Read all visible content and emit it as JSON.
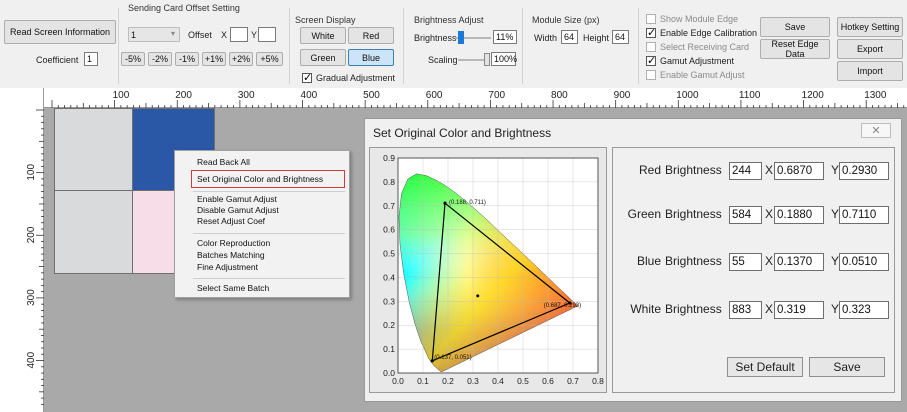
{
  "toolbar": {
    "read_screen_info": "Read Screen Information",
    "coefficient_label": "Coefficient",
    "coefficient_value": "1",
    "sending_card": {
      "title": "Sending Card Offset Setting",
      "selected": "1",
      "offset_label": "Offset",
      "x_label": "X",
      "y_label": "Y",
      "x_value": "",
      "y_value": "",
      "steps": [
        "-5%",
        "-2%",
        "-1%",
        "+1%",
        "+2%",
        "+5%"
      ]
    },
    "screen_display": {
      "title": "Screen Display",
      "white": "White",
      "red": "Red",
      "green": "Green",
      "blue": "Blue",
      "gradual": "Gradual Adjustment"
    },
    "brightness_adjust": {
      "title": "Brightness Adjust",
      "brightness_label": "Brightness",
      "brightness_value": "11%",
      "brightness_level": 0.11,
      "scaling_label": "Scaling",
      "scaling_value": "100%",
      "scaling_level": 1.0
    },
    "module_size": {
      "title": "Module Size (px)",
      "width_label": "Width",
      "width_value": "64",
      "height_label": "Height",
      "height_value": "64"
    },
    "options": {
      "show_module_edge": "Show Module Edge",
      "enable_edge_calibration": "Enable Edge Calibration",
      "select_receiving_card": "Select Receiving Card",
      "gamut_adjustment": "Gamut Adjustment",
      "enable_gamut_adjust": "Enable Gamut Adjust"
    },
    "save": "Save",
    "reset_edge_data": "Reset Edge Data",
    "hotkey_setting": "Hotkey Setting",
    "export": "Export",
    "import": "Import"
  },
  "ruler": {
    "top_labels": [
      "100",
      "200",
      "300",
      "400",
      "500",
      "600",
      "700",
      "800",
      "900",
      "1000",
      "1100",
      "1200",
      "1300"
    ],
    "left_labels": [
      "100",
      "200",
      "300",
      "400"
    ]
  },
  "context_menu": {
    "items": [
      "Read Back All",
      "Set Original Color and Brightness",
      "Enable Gamut Adjust",
      "Disable Gamut Adjust",
      "Reset Adjust Coef",
      "Color Reproduction",
      "Batches Matching",
      "Fine Adjustment",
      "Select Same Batch"
    ]
  },
  "dialog": {
    "title": "Set Original Color and Brightness",
    "close_symbol": "✕",
    "rows": [
      {
        "name": "Red",
        "brightness_label": "Brightness",
        "brightness": "244",
        "x": "0.6870",
        "y": "0.2930"
      },
      {
        "name": "Green",
        "brightness_label": "Brightness",
        "brightness": "584",
        "x": "0.1880",
        "y": "0.7110"
      },
      {
        "name": "Blue",
        "brightness_label": "Brightness",
        "brightness": "55",
        "x": "0.1370",
        "y": "0.0510"
      },
      {
        "name": "White",
        "brightness_label": "Brightness",
        "brightness": "883",
        "x": "0.319",
        "y": "0.323"
      }
    ],
    "x_label": "X",
    "y_label": "Y",
    "set_default": "Set Default",
    "save": "Save"
  },
  "chart_data": {
    "type": "scatter",
    "title": "",
    "xlim": [
      0.0,
      0.8
    ],
    "ylim": [
      0.0,
      0.9
    ],
    "x_ticks": [
      "0.0",
      "0.1",
      "0.2",
      "0.3",
      "0.4",
      "0.5",
      "0.6",
      "0.7",
      "0.8"
    ],
    "y_ticks": [
      "0.0",
      "0.1",
      "0.2",
      "0.3",
      "0.4",
      "0.5",
      "0.6",
      "0.7",
      "0.8",
      "0.9"
    ],
    "triangle": [
      {
        "x": 0.188,
        "y": 0.711,
        "label": "(0.188, 0.711)"
      },
      {
        "x": 0.687,
        "y": 0.293,
        "label": "(0.687, 0.293)"
      },
      {
        "x": 0.137,
        "y": 0.051,
        "label": "(0.137, 0.051)"
      }
    ],
    "white_point": {
      "x": 0.319,
      "y": 0.323
    },
    "grid": true
  },
  "colors": {
    "selected_button": "#cce4f7",
    "cell_blue": "#2a57a6",
    "cell_pink": "#f6dde8",
    "cell_gray": "#d8dadc",
    "highlight_border": "#d23b3b"
  }
}
